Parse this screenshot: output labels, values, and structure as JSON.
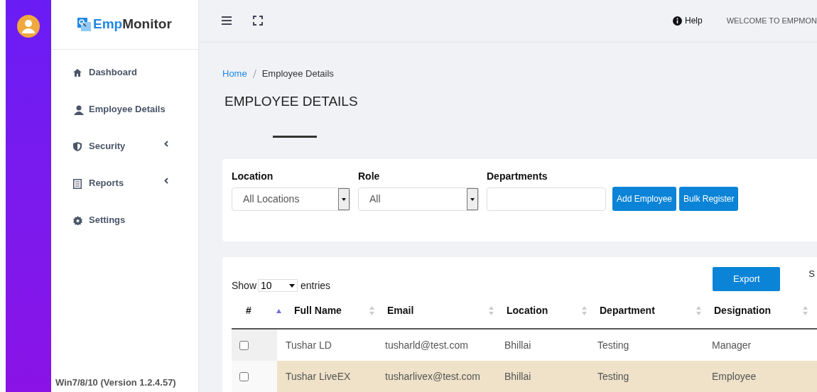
{
  "brand": {
    "part1": "Emp",
    "part2": "Monitor"
  },
  "sidebar": {
    "items": [
      {
        "label": "Dashboard",
        "submenu": false
      },
      {
        "label": "Employee Details",
        "submenu": false
      },
      {
        "label": "Security",
        "submenu": true
      },
      {
        "label": "Reports",
        "submenu": true
      },
      {
        "label": "Settings",
        "submenu": false
      }
    ],
    "footer": "Win7/8/10 (Version 1.2.4.57)"
  },
  "topbar": {
    "help": "Help",
    "welcome": "WELCOME TO EMPMON"
  },
  "breadcrumb": [
    "Home",
    "Employee Details"
  ],
  "page_title": "EMPLOYEE DETAILS",
  "filters": {
    "location": {
      "label": "Location",
      "value": "All Locations"
    },
    "role": {
      "label": "Role",
      "value": "All"
    },
    "departments": {
      "label": "Departments"
    },
    "buttons": [
      "Add Employee",
      "Bulk Register"
    ]
  },
  "table": {
    "show": "Show",
    "page_size": "10",
    "entries": "entries",
    "export": "Export",
    "search_cut": "S",
    "select_column": {
      "header": "#"
    },
    "columns": [
      "Full Name",
      "Email",
      "Location",
      "Department",
      "Designation"
    ],
    "rows": [
      {
        "checked": false,
        "highlighted": false,
        "cells": [
          "Tushar LD",
          "tusharld@test.com",
          "Bhillai",
          "Testing",
          "Manager"
        ]
      },
      {
        "checked": false,
        "highlighted": true,
        "cells": [
          "Tushar LiveEX",
          "tusharlivex@test.com",
          "Bhillai",
          "Testing",
          "Employee"
        ]
      }
    ]
  }
}
